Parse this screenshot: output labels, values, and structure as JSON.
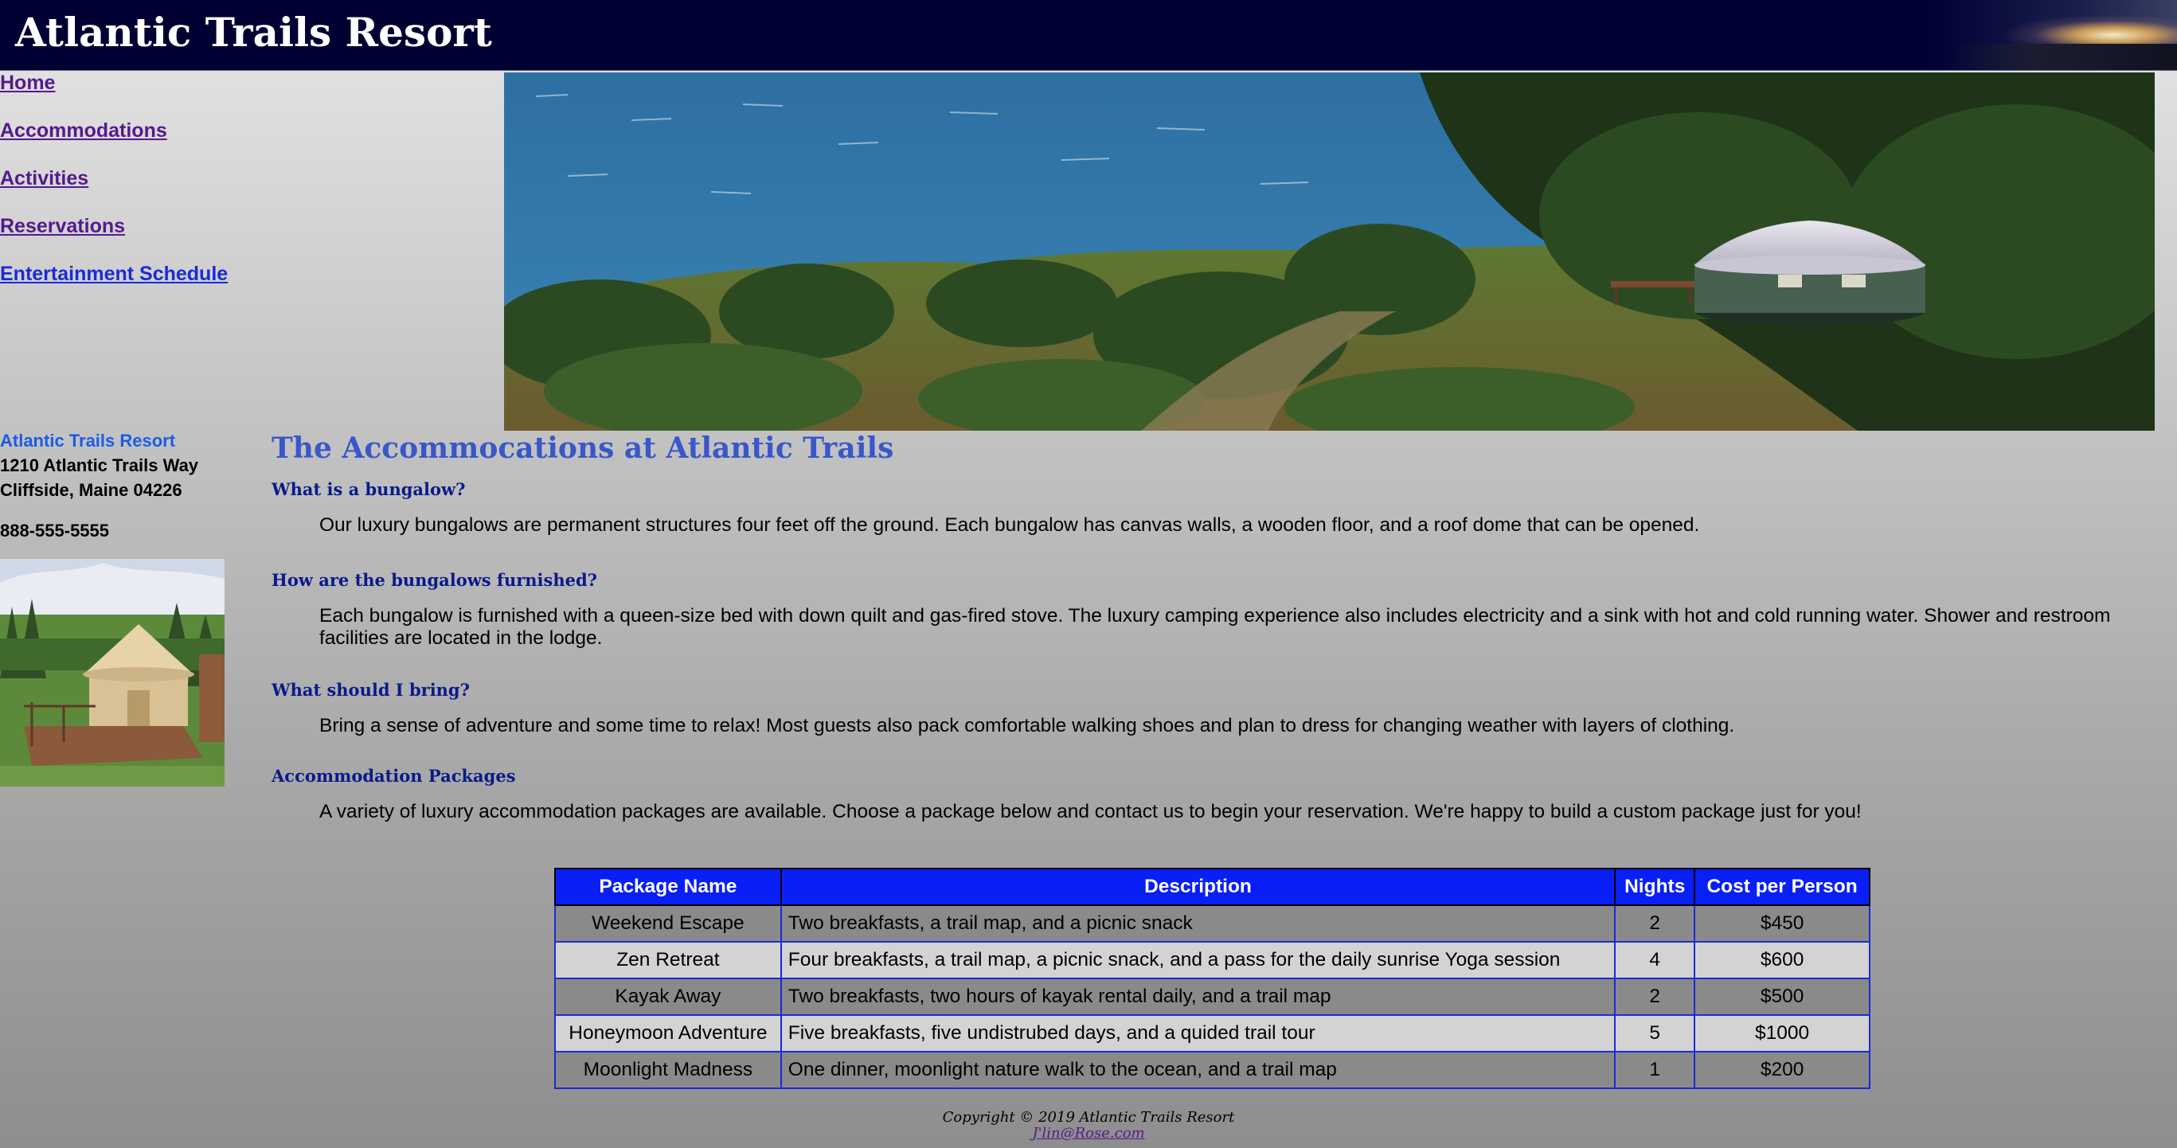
{
  "header": {
    "title": "Atlantic Trails Resort"
  },
  "nav": {
    "items": [
      {
        "label": "Home"
      },
      {
        "label": "Accommodations"
      },
      {
        "label": "Activities"
      },
      {
        "label": "Reservations"
      },
      {
        "label": "Entertainment Schedule"
      }
    ]
  },
  "contact": {
    "name": "Atlantic Trails Resort",
    "street": "1210 Atlantic Trails Way",
    "city": "Cliffside, Maine 04226",
    "phone": "888-555-5555"
  },
  "main": {
    "heading": "The Accommocations at Atlantic Trails",
    "sections": [
      {
        "question": "What is a bungalow?",
        "answer": "Our luxury bungalows are permanent structures four feet off the ground. Each bungalow has canvas walls, a wooden floor, and a roof dome that can be opened."
      },
      {
        "question": "How are the bungalows furnished?",
        "answer": "Each bungalow is furnished with a queen-size bed with down quilt and gas-fired stove. The luxury camping experience also includes electricity and a sink with hot and cold running water. Shower and restroom facilities are located in the lodge."
      },
      {
        "question": "What should I bring?",
        "answer": "Bring a sense of adventure and some time to relax! Most guests also pack comfortable walking shoes and plan to dress for changing weather with layers of clothing."
      },
      {
        "question": "Accommodation Packages",
        "answer": "A variety of luxury accommodation packages are available. Choose a package below and contact us to begin your reservation. We're happy to build a custom package just for you!"
      }
    ]
  },
  "packages": {
    "headers": [
      "Package Name",
      "Description",
      "Nights",
      "Cost per Person"
    ],
    "rows": [
      [
        "Weekend Escape",
        "Two breakfasts, a trail map, and a picnic snack",
        "2",
        "$450"
      ],
      [
        "Zen Retreat",
        "Four breakfasts, a trail map, a picnic snack, and a pass for the daily sunrise Yoga session",
        "4",
        "$600"
      ],
      [
        "Kayak Away",
        "Two breakfasts, two hours of kayak rental daily, and a trail map",
        "2",
        "$500"
      ],
      [
        "Honeymoon Adventure",
        "Five breakfasts, five undistrubed days, and a quided trail tour",
        "5",
        "$1000"
      ],
      [
        "Moonlight Madness",
        "One dinner, moonlight nature walk to the ocean, and a trail map",
        "1",
        "$200"
      ]
    ]
  },
  "footer": {
    "copyright": "Copyright © 2019 Atlantic Trails Resort",
    "email": "J'lin@Rose.com"
  }
}
